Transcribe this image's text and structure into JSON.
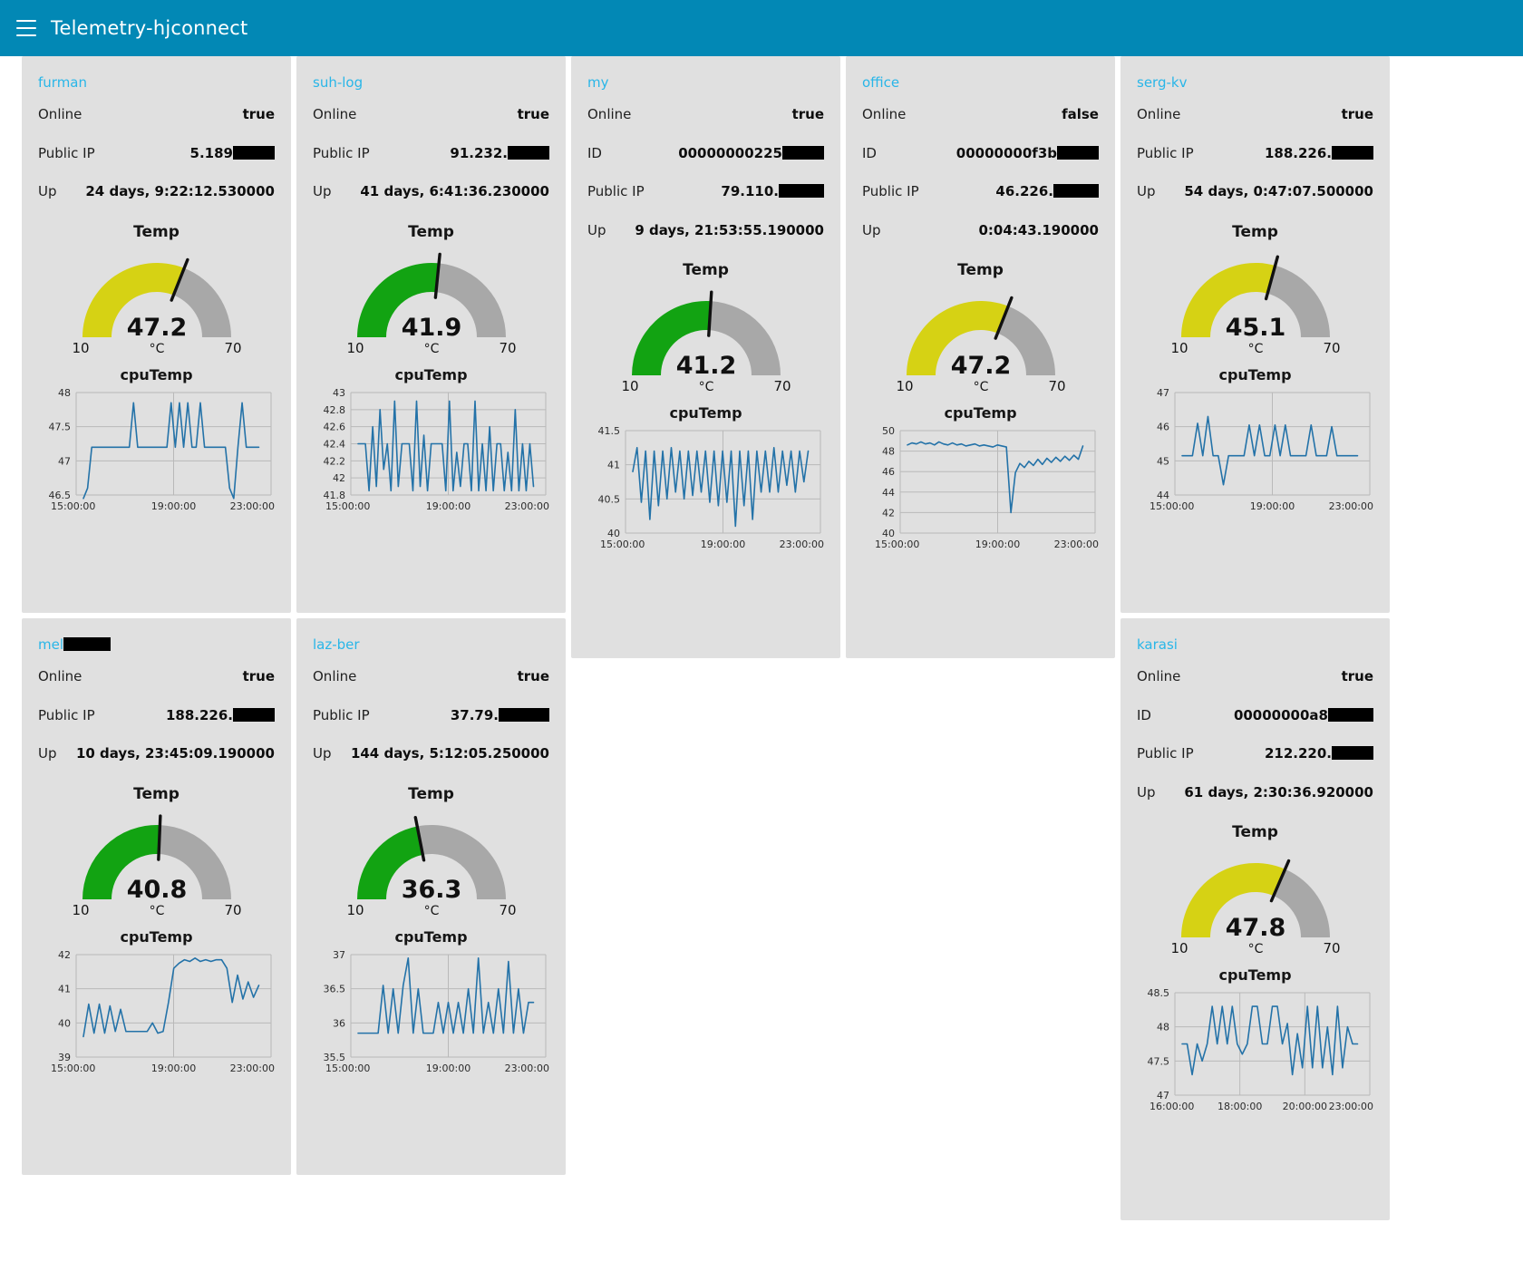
{
  "header": {
    "menu_icon": "hamburger-icon",
    "title": "Telemetry-hjconnect",
    "accent": "#0288b5"
  },
  "labels": {
    "online": "Online",
    "public_ip": "Public IP",
    "id": "ID",
    "up": "Up",
    "gauge_title": "Temp",
    "gauge_unit": "°C",
    "chart_title": "cpuTemp"
  },
  "colors": {
    "panel_bg": "#e0e0e0",
    "title_blue": "#29b6e8",
    "gauge_yellow": "#d6d214",
    "gauge_green": "#12a312",
    "gauge_grey": "#a8a8a8",
    "series": "#2372a8"
  },
  "panels": [
    {
      "name": "furman",
      "name_redacted": false,
      "rows": [
        {
          "key": "Online",
          "value": "true"
        },
        {
          "key": "Public IP",
          "value": "5.189",
          "redacted": true,
          "redact_width": 46
        },
        {
          "key": "Up",
          "value": "24 days, 9:22:12.530000"
        }
      ],
      "gauge": {
        "title": "Temp",
        "value": "47.2",
        "unit": "°C",
        "min": "10",
        "max": "70",
        "color": "yellow"
      },
      "chart_data": {
        "type": "line",
        "title": "cpuTemp",
        "ylabel": "",
        "xlabel": "",
        "yticks": [
          "48",
          "47.5",
          "47",
          "46.5"
        ],
        "ylim": [
          46.5,
          48.0
        ],
        "xticks": [
          "15:00:00",
          "19:00:00",
          "23:00:00"
        ],
        "grid": true,
        "series": [
          {
            "name": "cpuTemp",
            "values": [
              46.45,
              46.6,
              47.2,
              47.2,
              47.2,
              47.2,
              47.2,
              47.2,
              47.2,
              47.2,
              47.2,
              47.2,
              47.85,
              47.2,
              47.2,
              47.2,
              47.2,
              47.2,
              47.2,
              47.2,
              47.2,
              47.85,
              47.2,
              47.85,
              47.2,
              47.85,
              47.2,
              47.2,
              47.85,
              47.2,
              47.2,
              47.2,
              47.2,
              47.2,
              47.2,
              46.6,
              46.45,
              47.2,
              47.85,
              47.2,
              47.2,
              47.2,
              47.2
            ]
          }
        ]
      }
    },
    {
      "name": "suh-log",
      "name_redacted": false,
      "rows": [
        {
          "key": "Online",
          "value": "true"
        },
        {
          "key": "Public IP",
          "value": "91.232.",
          "redacted": true,
          "redact_width": 46
        },
        {
          "key": "Up",
          "value": "41 days, 6:41:36.230000"
        }
      ],
      "gauge": {
        "title": "Temp",
        "value": "41.9",
        "unit": "°C",
        "min": "10",
        "max": "70",
        "color": "green"
      },
      "chart_data": {
        "type": "line",
        "title": "cpuTemp",
        "yticks": [
          "43",
          "42.8",
          "42.6",
          "42.4",
          "42.2",
          "42",
          "41.8"
        ],
        "ylim": [
          41.8,
          43.0
        ],
        "xticks": [
          "15:00:00",
          "19:00:00",
          "23:00:00"
        ],
        "grid": true,
        "series": [
          {
            "name": "cpuTemp",
            "values": [
              42.4,
              42.4,
              42.4,
              41.85,
              42.6,
              41.9,
              42.8,
              42.1,
              42.4,
              41.85,
              42.9,
              41.9,
              42.4,
              42.4,
              42.4,
              41.85,
              42.9,
              41.9,
              42.5,
              41.85,
              42.4,
              42.4,
              42.4,
              42.4,
              41.85,
              42.9,
              41.85,
              42.3,
              41.9,
              42.4,
              42.4,
              41.85,
              42.9,
              41.85,
              42.4,
              41.85,
              42.6,
              41.85,
              42.4,
              42.4,
              41.85,
              42.3,
              41.85,
              42.8,
              41.85,
              42.4,
              41.85,
              42.4,
              41.9
            ]
          }
        ]
      }
    },
    {
      "name": "my",
      "name_redacted": false,
      "rows": [
        {
          "key": "Online",
          "value": "true"
        },
        {
          "key": "ID",
          "value": "00000000225",
          "redacted": true,
          "redact_width": 46
        },
        {
          "key": "Public IP",
          "value": "79.110.",
          "redacted": true,
          "redact_width": 50
        },
        {
          "key": "Up",
          "value": "9 days, 21:53:55.190000"
        }
      ],
      "gauge": {
        "title": "Temp",
        "value": "41.2",
        "unit": "°C",
        "min": "10",
        "max": "70",
        "color": "green"
      },
      "chart_data": {
        "type": "line",
        "title": "cpuTemp",
        "yticks": [
          "41.5",
          "41",
          "40.5",
          "40"
        ],
        "ylim": [
          40.0,
          41.5
        ],
        "xticks": [
          "15:00:00",
          "19:00:00",
          "23:00:00"
        ],
        "grid": true,
        "series": [
          {
            "name": "cpuTemp",
            "values": [
              40.9,
              41.25,
              40.45,
              41.2,
              40.2,
              41.2,
              40.4,
              41.2,
              40.5,
              41.25,
              40.6,
              41.2,
              40.5,
              41.2,
              40.55,
              41.2,
              40.6,
              41.2,
              40.45,
              41.2,
              40.4,
              41.2,
              40.45,
              41.2,
              40.1,
              41.2,
              40.4,
              41.2,
              40.2,
              41.2,
              40.6,
              41.2,
              40.6,
              41.25,
              40.6,
              41.2,
              40.7,
              41.2,
              40.6,
              41.2,
              40.75,
              41.2
            ]
          }
        ]
      }
    },
    {
      "name": "office",
      "name_redacted": false,
      "rows": [
        {
          "key": "Online",
          "value": "false"
        },
        {
          "key": "ID",
          "value": "00000000f3b",
          "redacted": true,
          "redact_width": 46
        },
        {
          "key": "Public IP",
          "value": "46.226.",
          "redacted": true,
          "redact_width": 50
        },
        {
          "key": "Up",
          "value": "0:04:43.190000"
        }
      ],
      "gauge": {
        "title": "Temp",
        "value": "47.2",
        "unit": "°C",
        "min": "10",
        "max": "70",
        "color": "yellow"
      },
      "chart_data": {
        "type": "line",
        "title": "cpuTemp",
        "yticks": [
          "50",
          "48",
          "46",
          "44",
          "42",
          "40"
        ],
        "ylim": [
          40,
          50
        ],
        "xticks": [
          "15:00:00",
          "19:00:00",
          "23:00:00"
        ],
        "grid": true,
        "series": [
          {
            "name": "cpuTemp",
            "values": [
              48.6,
              48.8,
              48.7,
              48.9,
              48.7,
              48.8,
              48.6,
              48.9,
              48.7,
              48.6,
              48.8,
              48.6,
              48.7,
              48.5,
              48.6,
              48.7,
              48.5,
              48.6,
              48.5,
              48.4,
              48.6,
              48.5,
              48.4,
              42.0,
              45.9,
              46.8,
              46.4,
              47.0,
              46.6,
              47.2,
              46.7,
              47.3,
              46.9,
              47.4,
              47.0,
              47.5,
              47.1,
              47.6,
              47.2,
              48.5
            ]
          }
        ]
      }
    },
    {
      "name": "serg-kv",
      "name_redacted": false,
      "rows": [
        {
          "key": "Online",
          "value": "true"
        },
        {
          "key": "Public IP",
          "value": "188.226.",
          "redacted": true,
          "redact_width": 46
        },
        {
          "key": "Up",
          "value": "54 days, 0:47:07.500000"
        }
      ],
      "gauge": {
        "title": "Temp",
        "value": "45.1",
        "unit": "°C",
        "min": "10",
        "max": "70",
        "color": "yellow"
      },
      "chart_data": {
        "type": "line",
        "title": "cpuTemp",
        "yticks": [
          "47",
          "46",
          "45",
          "44"
        ],
        "ylim": [
          44,
          47
        ],
        "xticks": [
          "15:00:00",
          "19:00:00",
          "23:00:00"
        ],
        "grid": true,
        "series": [
          {
            "name": "cpuTemp",
            "values": [
              45.15,
              45.15,
              45.15,
              46.1,
              45.15,
              46.3,
              45.15,
              45.15,
              44.3,
              45.15,
              45.15,
              45.15,
              45.15,
              46.05,
              45.15,
              46.05,
              45.15,
              45.15,
              46.05,
              45.15,
              46.05,
              45.15,
              45.15,
              45.15,
              45.15,
              46.05,
              45.15,
              45.15,
              45.15,
              46.0,
              45.15,
              45.15,
              45.15,
              45.15,
              45.15
            ]
          }
        ]
      }
    },
    {
      "name": "mel",
      "name_redacted": true,
      "name_redact_width": 52,
      "rows": [
        {
          "key": "Online",
          "value": "true"
        },
        {
          "key": "Public IP",
          "value": "188.226.",
          "redacted": true,
          "redact_width": 46
        },
        {
          "key": "Up",
          "value": "10 days, 23:45:09.190000"
        }
      ],
      "gauge": {
        "title": "Temp",
        "value": "40.8",
        "unit": "°C",
        "min": "10",
        "max": "70",
        "color": "green"
      },
      "chart_data": {
        "type": "line",
        "title": "cpuTemp",
        "yticks": [
          "42",
          "41",
          "40",
          "39"
        ],
        "ylim": [
          39,
          42
        ],
        "xticks": [
          "15:00:00",
          "19:00:00",
          "23:00:00"
        ],
        "grid": true,
        "series": [
          {
            "name": "cpuTemp",
            "values": [
              39.6,
              40.55,
              39.7,
              40.55,
              39.7,
              40.5,
              39.75,
              40.4,
              39.75,
              39.75,
              39.75,
              39.75,
              39.75,
              40.0,
              39.7,
              39.75,
              40.6,
              41.6,
              41.75,
              41.85,
              41.8,
              41.9,
              41.8,
              41.85,
              41.8,
              41.85,
              41.85,
              41.6,
              40.6,
              41.4,
              40.7,
              41.2,
              40.75,
              41.1
            ]
          }
        ]
      }
    },
    {
      "name": "laz-ber",
      "name_redacted": false,
      "rows": [
        {
          "key": "Online",
          "value": "true"
        },
        {
          "key": "Public IP",
          "value": "37.79.",
          "redacted": true,
          "redact_width": 56
        },
        {
          "key": "Up",
          "value": "144 days, 5:12:05.250000"
        }
      ],
      "gauge": {
        "title": "Temp",
        "value": "36.3",
        "unit": "°C",
        "min": "10",
        "max": "70",
        "color": "green"
      },
      "chart_data": {
        "type": "line",
        "title": "cpuTemp",
        "yticks": [
          "37",
          "36.5",
          "36",
          "35.5"
        ],
        "ylim": [
          35.5,
          37
        ],
        "xticks": [
          "15:00:00",
          "19:00:00",
          "23:00:00"
        ],
        "grid": true,
        "series": [
          {
            "name": "cpuTemp",
            "values": [
              35.85,
              35.85,
              35.85,
              35.85,
              35.85,
              36.55,
              35.85,
              36.5,
              35.85,
              36.55,
              36.95,
              35.85,
              36.5,
              35.85,
              35.85,
              35.85,
              36.3,
              35.85,
              36.3,
              35.85,
              36.3,
              35.85,
              36.5,
              35.85,
              36.95,
              35.85,
              36.3,
              35.85,
              36.5,
              35.85,
              36.9,
              35.85,
              36.5,
              35.85,
              36.3,
              36.3
            ]
          }
        ]
      }
    },
    {
      "name": "karasi",
      "name_redacted": false,
      "rows": [
        {
          "key": "Online",
          "value": "true"
        },
        {
          "key": "ID",
          "value": "00000000a8",
          "redacted": true,
          "redact_width": 50
        },
        {
          "key": "Public IP",
          "value": "212.220.",
          "redacted": true,
          "redact_width": 46
        },
        {
          "key": "Up",
          "value": "61 days, 2:30:36.920000"
        }
      ],
      "gauge": {
        "title": "Temp",
        "value": "47.8",
        "unit": "°C",
        "min": "10",
        "max": "70",
        "color": "yellow"
      },
      "chart_data": {
        "type": "line",
        "title": "cpuTemp",
        "yticks": [
          "48.5",
          "48",
          "47.5",
          "47"
        ],
        "ylim": [
          47,
          48.5
        ],
        "xticks": [
          "16:00:00",
          "18:00:00",
          "20:00:00",
          "23:00:00"
        ],
        "grid": true,
        "series": [
          {
            "name": "cpuTemp",
            "values": [
              47.75,
              47.75,
              47.3,
              47.75,
              47.5,
              47.75,
              48.3,
              47.75,
              48.3,
              47.75,
              48.3,
              47.75,
              47.6,
              47.75,
              48.3,
              48.3,
              47.75,
              47.75,
              48.3,
              48.3,
              47.75,
              48.05,
              47.3,
              47.9,
              47.4,
              48.3,
              47.4,
              48.3,
              47.4,
              48.0,
              47.3,
              48.3,
              47.4,
              48.0,
              47.75,
              47.75
            ]
          }
        ]
      }
    }
  ]
}
